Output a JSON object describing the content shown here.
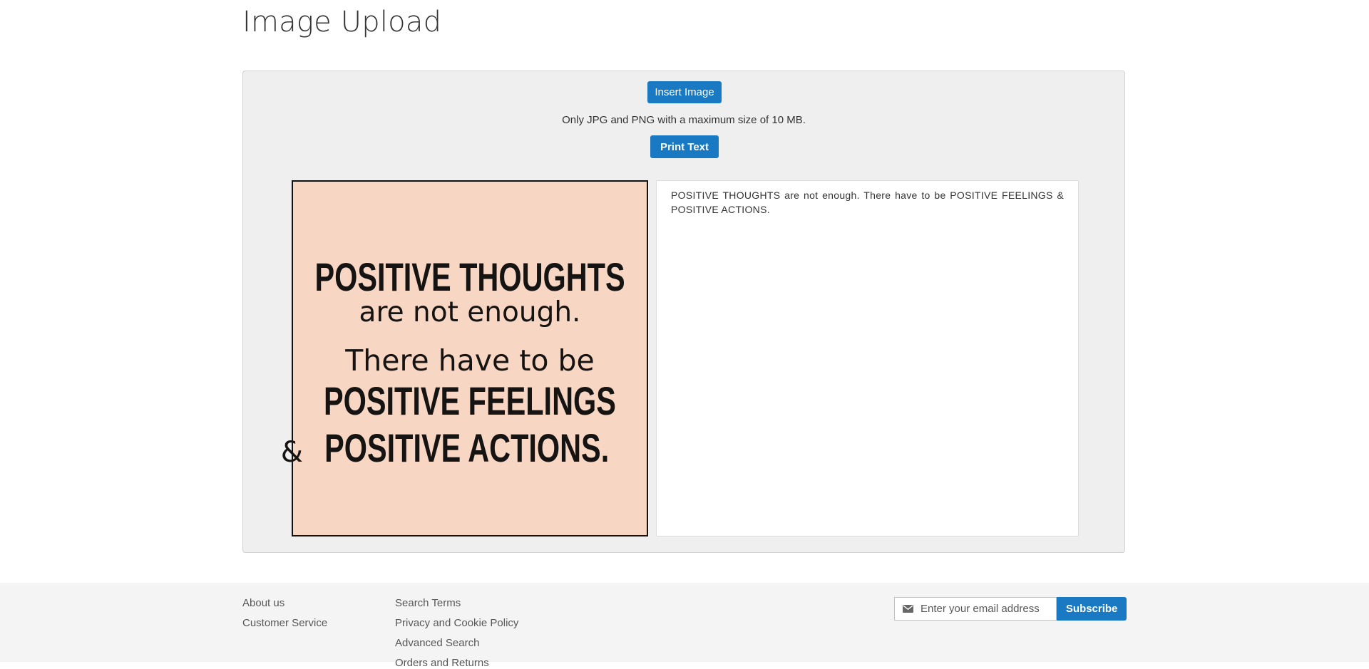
{
  "page": {
    "title": "Image Upload"
  },
  "upload": {
    "insert_label": "Insert Image",
    "hint": "Only JPG and PNG with a maximum size of 10 MB.",
    "print_label": "Print Text"
  },
  "preview": {
    "lines": [
      "POSITIVE THOUGHTS",
      "are not enough.",
      "There have to be",
      "POSITIVE FEELINGS",
      "&",
      "POSITIVE ACTIONS."
    ],
    "background_color": "#f8d6c4"
  },
  "output": {
    "text": "POSITIVE THOUGHTS are not enough. There have to be POSITIVE FEELINGS & POSITIVE ACTIONS."
  },
  "footer": {
    "links_col1": [
      "About us",
      "Customer Service"
    ],
    "links_col2": [
      "Search Terms",
      "Privacy and Cookie Policy",
      "Advanced Search",
      "Orders and Returns"
    ],
    "newsletter": {
      "placeholder": "Enter your email address",
      "subscribe_label": "Subscribe",
      "icon": "mail-icon"
    }
  },
  "colors": {
    "accent": "#1979c3",
    "panel": "#efefef",
    "footer": "#f4f4f4"
  }
}
